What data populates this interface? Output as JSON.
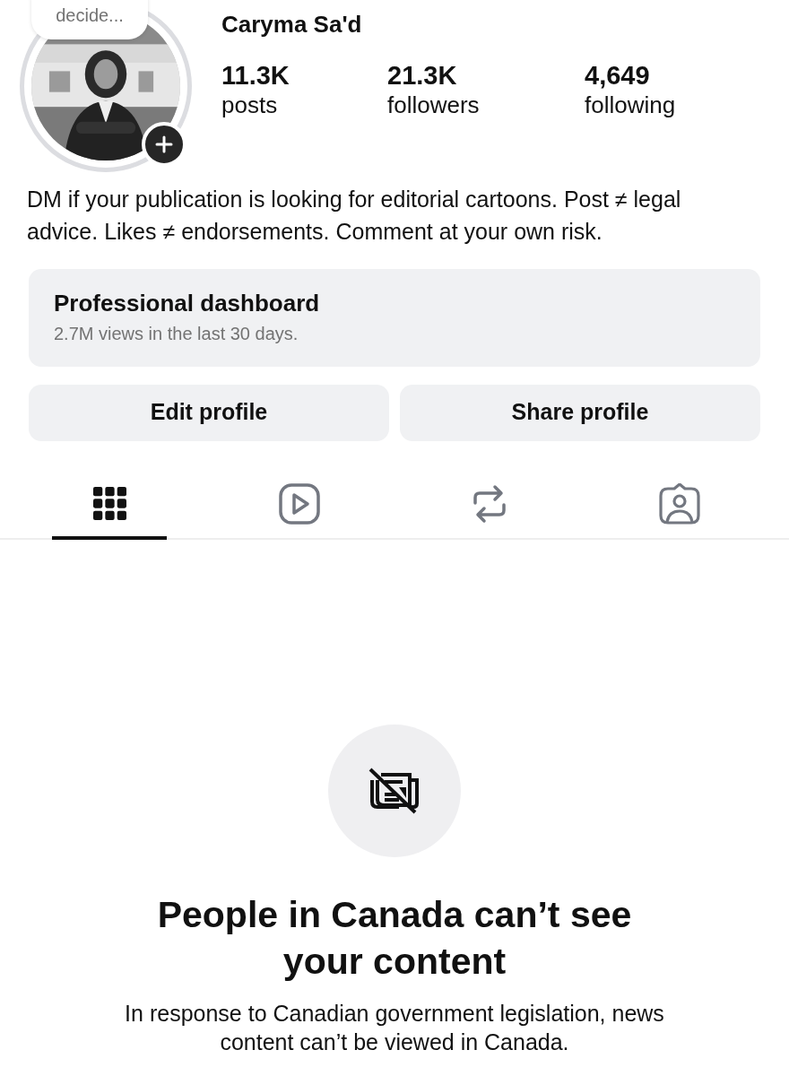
{
  "profile": {
    "note": "decide...",
    "name": "Caryma Sa'd",
    "stats": [
      {
        "value": "11.3K",
        "label": "posts"
      },
      {
        "value": "21.3K",
        "label": "followers"
      },
      {
        "value": "4,649",
        "label": "following"
      }
    ],
    "bio": "DM if your publication is looking for editorial cartoons. Post ≠ legal advice. Likes ≠ endorsements. Comment at your own risk."
  },
  "dashboard": {
    "title": "Professional dashboard",
    "subtitle": "2.7M views in the last 30 days."
  },
  "buttons": [
    "Edit profile",
    "Share profile"
  ],
  "tabs": [
    {
      "kind": "grid",
      "selected": true
    },
    {
      "kind": "reels",
      "selected": false
    },
    {
      "kind": "reposts",
      "selected": false
    },
    {
      "kind": "tagged",
      "selected": false
    }
  ],
  "empty_state": {
    "title": "People in Canada can’t see your content",
    "message": "In response to Canadian government legislation, news content can’t be viewed in Canada."
  }
}
